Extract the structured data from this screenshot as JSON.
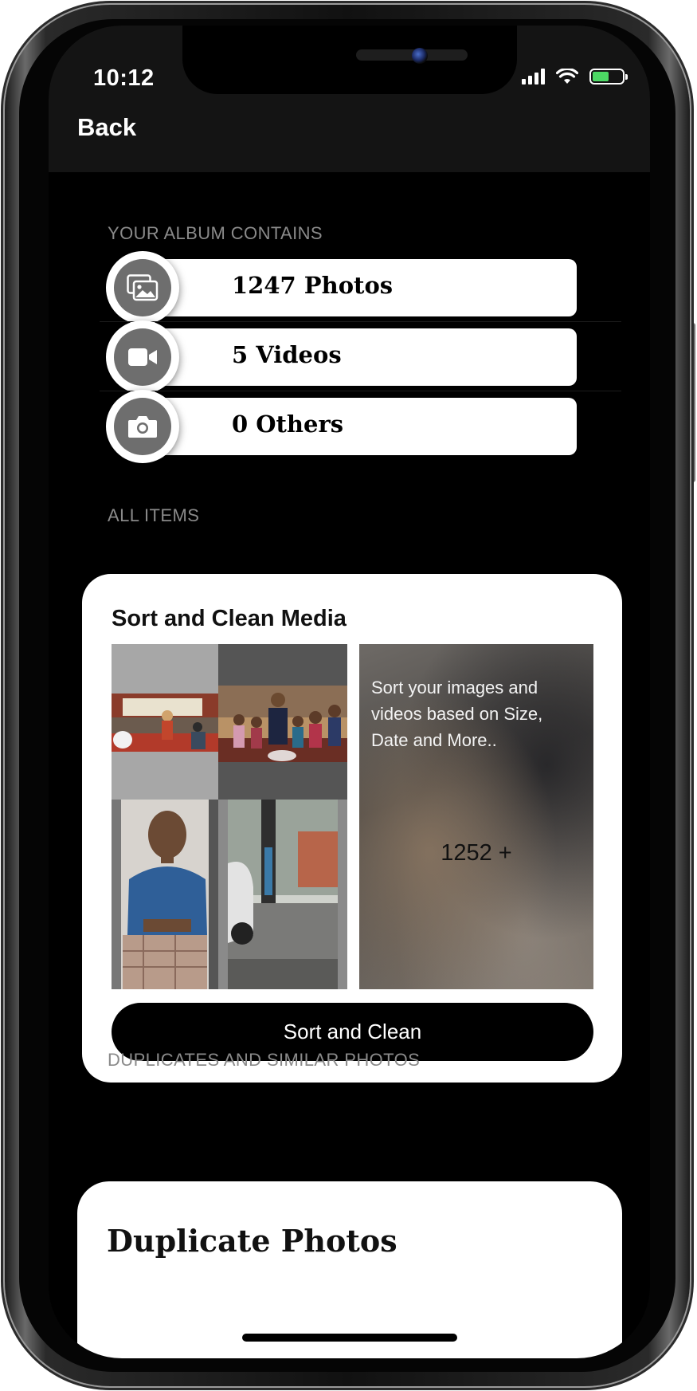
{
  "status_bar": {
    "time": "10:12",
    "icons": [
      "signal-icon",
      "wifi-icon",
      "battery-icon"
    ]
  },
  "nav": {
    "back_label": "Back"
  },
  "album": {
    "section_label": "YOUR ALBUM CONTAINS",
    "rows": [
      {
        "label": "1247 Photos",
        "icon": "photos-icon"
      },
      {
        "label": "5 Videos",
        "icon": "video-camera-icon"
      },
      {
        "label": "0 Others",
        "icon": "camera-icon"
      }
    ]
  },
  "all_items": {
    "section_label": "ALL ITEMS",
    "card_title": "Sort and Clean Media",
    "promo_text": "Sort your images and videos based on Size, Date and More..",
    "promo_count": "1252 +",
    "button_label": "Sort and Clean"
  },
  "duplicates": {
    "section_label": "DUPLICATES AND SIMILAR PHOTOS",
    "card_title": "Duplicate Photos"
  },
  "colors": {
    "background": "#000000",
    "topbar": "#141414",
    "card": "#ffffff",
    "icon_circle": "#6e6e6e",
    "label_gray": "#8a8a8a"
  }
}
